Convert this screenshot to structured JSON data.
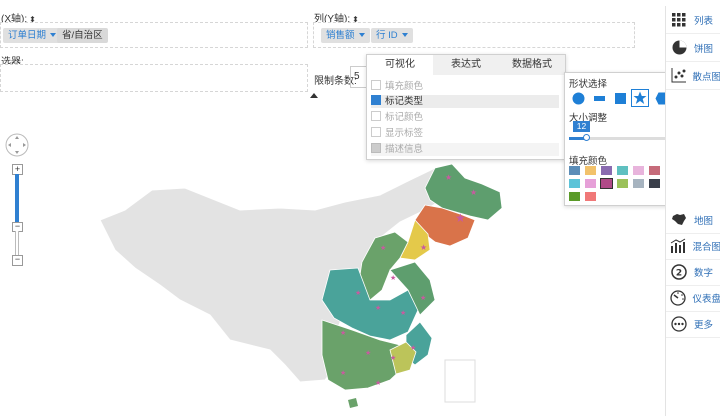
{
  "toolbar": {
    "x_axis_label": "(X轴):",
    "y_axis_label": "列(Y轴):",
    "filter_label": "选器:",
    "limit_label": "限制条数:",
    "limit_value": "5",
    "x_fields": [
      "订单日期",
      "省/自治区"
    ],
    "y_fields": [
      "销售额",
      "行 ID"
    ]
  },
  "viz_popup": {
    "tabs": [
      "可视化",
      "表达式",
      "数据格式"
    ],
    "active_tab": "可视化",
    "options": [
      {
        "label": "填充颜色",
        "state": "off"
      },
      {
        "label": "标记类型",
        "state": "on"
      },
      {
        "label": "标记颜色",
        "state": "off"
      },
      {
        "label": "显示标签",
        "state": "off"
      },
      {
        "label": "描述信息",
        "state": "half"
      }
    ]
  },
  "shape_panel": {
    "title": "形状选择",
    "shapes": [
      "circle-icon",
      "line-icon",
      "square-icon",
      "star-icon",
      "hexagon-icon",
      "diamond-icon",
      "triangle-icon"
    ],
    "selected_shape": "star-icon",
    "size_label": "大小调整",
    "size_value": "12",
    "size_max": "100",
    "size_fraction": 0.12,
    "color_label": "填充颜色",
    "colors": [
      "#5b8db8",
      "#f2c26b",
      "#8a6bb0",
      "#5fc0c0",
      "#e8b4dc",
      "#c66b7a",
      "#6bbf8c",
      "#f0b838",
      "#4a4a8a",
      "#5cc3d8",
      "#e6a0d8",
      "#b04a88",
      "#9bc15a",
      "#a7b4c0",
      "#3a3f4a",
      "#c8c8c8",
      "#c89a28",
      "#9fd0e8",
      "#5a9a28",
      "#f07878"
    ],
    "selected_color": "#b04a88"
  },
  "chart_types": [
    {
      "icon": "grid-icon",
      "label": "列表"
    },
    {
      "icon": "pie-icon",
      "label": "饼图"
    },
    {
      "icon": "scatter-icon",
      "label": "散点图"
    },
    {
      "icon": "map-icon",
      "label": "地图"
    },
    {
      "icon": "combo-chart-icon",
      "label": "混合图"
    },
    {
      "icon": "number-icon",
      "label": "数字"
    },
    {
      "icon": "gauge-icon",
      "label": "仪表盘"
    },
    {
      "icon": "more-icon",
      "label": "更多"
    }
  ],
  "zoom": {
    "plus": "+",
    "minus": "−"
  },
  "colors": {
    "accent": "#2f80d1",
    "map_green": "#5e9e6e",
    "map_teal": "#4aa39a",
    "map_orange": "#d9734a",
    "map_yellow": "#e4c94a",
    "map_gray": "#e3e3e3",
    "marker": "#c95aa0"
  }
}
